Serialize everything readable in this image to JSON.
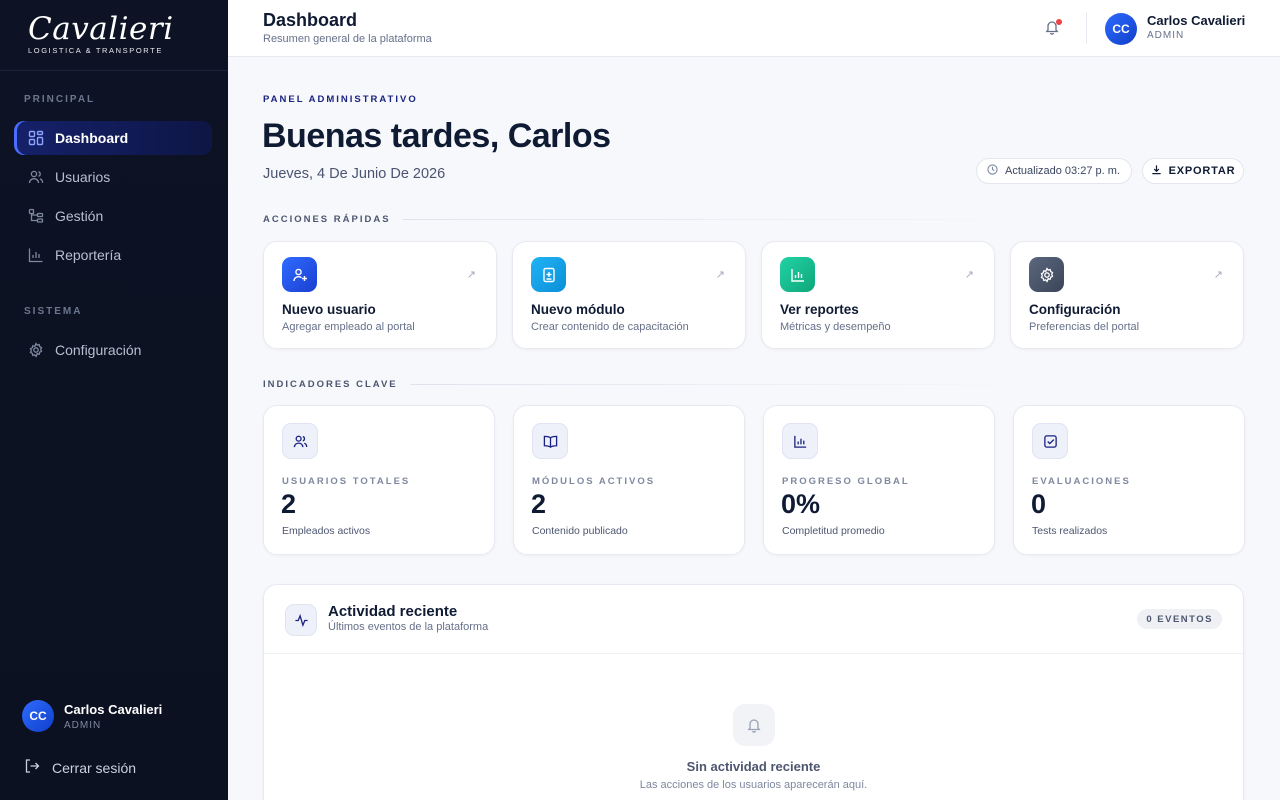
{
  "brand": {
    "name": "Cavalieri",
    "tagline": "LOGISTICA & TRANSPORTE"
  },
  "sidebar": {
    "section_principal": "PRINCIPAL",
    "section_sistema": "SISTEMA",
    "items": [
      {
        "label": "Dashboard",
        "icon": "grid-icon",
        "active": true
      },
      {
        "label": "Usuarios",
        "icon": "users-icon"
      },
      {
        "label": "Gestión",
        "icon": "tree-icon"
      },
      {
        "label": "Reportería",
        "icon": "bar-chart-icon"
      },
      {
        "label": "Configuración",
        "icon": "gear-icon"
      }
    ],
    "user": {
      "initials": "CC",
      "name": "Carlos Cavalieri",
      "role": "ADMIN"
    },
    "logout_label": "Cerrar sesión"
  },
  "header": {
    "title": "Dashboard",
    "subtitle": "Resumen general de la plataforma",
    "user": {
      "initials": "CC",
      "name": "Carlos Cavalieri",
      "role": "ADMIN"
    }
  },
  "main": {
    "eyebrow": "PANEL ADMINISTRATIVO",
    "greeting": "Buenas tardes, Carlos",
    "date": "Jueves, 4 De Junio De 2026",
    "updated": "Actualizado 03:27 p. m.",
    "export_label": "EXPORTAR",
    "quick_actions_label": "ACCIONES RÁPIDAS",
    "quick_actions": [
      {
        "title": "Nuevo usuario",
        "desc": "Agregar empleado al portal",
        "color": "#1f4fe0"
      },
      {
        "title": "Nuevo módulo",
        "desc": "Crear contenido de capacitación",
        "color": "#0ea5e9"
      },
      {
        "title": "Ver reportes",
        "desc": "Métricas y desempeño",
        "color": "#10b981"
      },
      {
        "title": "Configuración",
        "desc": "Preferencias del portal",
        "color": "#475569"
      }
    ],
    "kpi_label": "INDICADORES CLAVE",
    "kpis": [
      {
        "label": "USUARIOS TOTALES",
        "value": "2",
        "desc": "Empleados activos"
      },
      {
        "label": "MÓDULOS ACTIVOS",
        "value": "2",
        "desc": "Contenido publicado"
      },
      {
        "label": "PROGRESO GLOBAL",
        "value": "0%",
        "desc": "Completitud promedio"
      },
      {
        "label": "EVALUACIONES",
        "value": "0",
        "desc": "Tests realizados"
      }
    ],
    "activity": {
      "title": "Actividad reciente",
      "subtitle": "Últimos eventos de la plataforma",
      "badge": "0 EVENTOS",
      "empty_title": "Sin actividad reciente",
      "empty_subtitle": "Las acciones de los usuarios aparecerán aquí."
    }
  },
  "colors": {
    "sidebar_bg": "#0d1324",
    "accent": "#4a6cff",
    "notification": "#ef4444"
  }
}
